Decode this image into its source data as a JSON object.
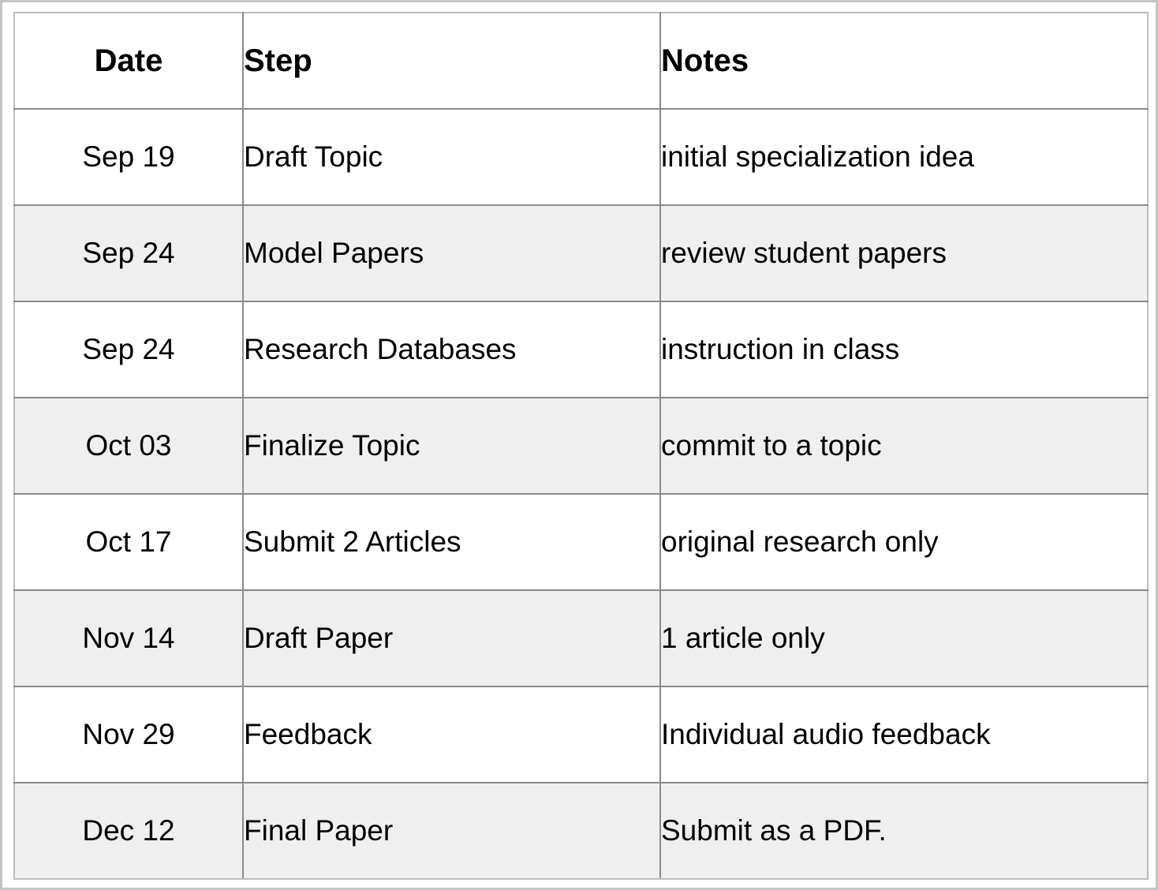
{
  "table": {
    "headers": {
      "date": "Date",
      "step": "Step",
      "notes": "Notes"
    },
    "rows": [
      {
        "date": "Sep 19",
        "step": "Draft Topic",
        "notes": "initial specialization idea"
      },
      {
        "date": "Sep 24",
        "step": "Model Papers",
        "notes": "review student papers"
      },
      {
        "date": "Sep 24",
        "step": "Research Databases",
        "notes": "instruction in class"
      },
      {
        "date": "Oct 03",
        "step": "Finalize Topic",
        "notes": "commit to a topic"
      },
      {
        "date": "Oct 17",
        "step": "Submit 2 Articles",
        "notes": "original research only"
      },
      {
        "date": "Nov 14",
        "step": "Draft Paper",
        "notes": "1 article only"
      },
      {
        "date": "Nov 29",
        "step": "Feedback",
        "notes": "Individual audio feedback"
      },
      {
        "date": "Dec 12",
        "step": "Final Paper",
        "notes": "Submit as a PDF."
      }
    ]
  },
  "colors": {
    "row_shade": "#efefef",
    "grid_line": "#8a8a8a",
    "outer_line": "#bdbdbd"
  }
}
